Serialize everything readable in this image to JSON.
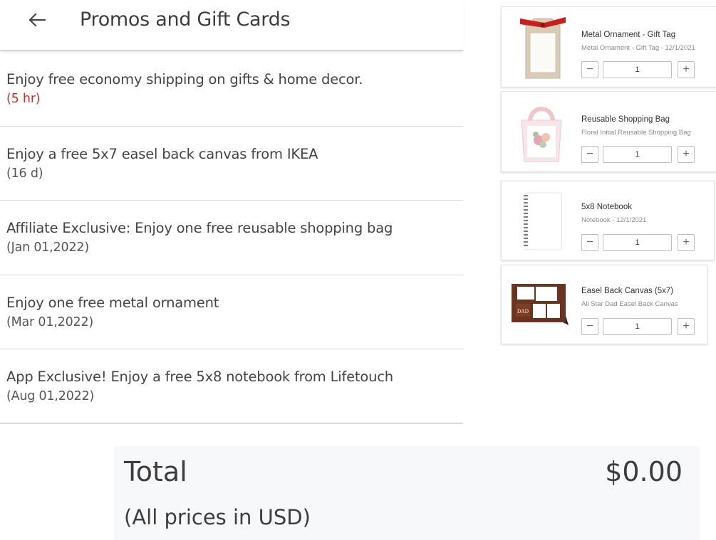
{
  "promos": {
    "title": "Promos and Gift Cards",
    "items": [
      {
        "text": "Enjoy free economy shipping on gifts & home decor.",
        "expiry": "(5 hr)",
        "expiry_color": "#d0312d"
      },
      {
        "text": "Enjoy a free 5x7 easel back canvas from IKEA",
        "expiry": "(16 d)"
      },
      {
        "text": "Affiliate Exclusive: Enjoy one free reusable shopping bag",
        "expiry": "(Jan 01,2022)"
      },
      {
        "text": "Enjoy one free metal ornament",
        "expiry": "(Mar 01,2022)"
      },
      {
        "text": "App Exclusive! Enjoy a free 5x8 notebook from Lifetouch",
        "expiry": "(Aug 01,2022)"
      }
    ]
  },
  "cart": {
    "items": [
      {
        "title": "Metal Ornament - Gift Tag",
        "subtitle": "Metal Ornament - Gift Tag - 12/1/2021",
        "quantity": "1",
        "minus": "−",
        "plus": "+"
      },
      {
        "title": "Reusable Shopping Bag",
        "subtitle": "Floral Initial Reusable Shopping Bag",
        "quantity": "1",
        "minus": "−",
        "plus": "+"
      },
      {
        "title": "5x8 Notebook",
        "subtitle": "Notebook - 12/1/2021",
        "quantity": "1",
        "minus": "−",
        "plus": "+"
      },
      {
        "title": "Easel Back Canvas (5x7)",
        "subtitle": "All Star Dad Easel Back Canvas",
        "quantity": "1",
        "minus": "−",
        "plus": "+"
      }
    ]
  },
  "total": {
    "label": "Total",
    "amount": "$0.00",
    "note": "(All prices in USD)"
  },
  "colors": {
    "urgent": "#d0312d",
    "text": "#3d3d3d",
    "total_bg": "#f7f8f9",
    "canvas_brown": "#6b3420"
  }
}
